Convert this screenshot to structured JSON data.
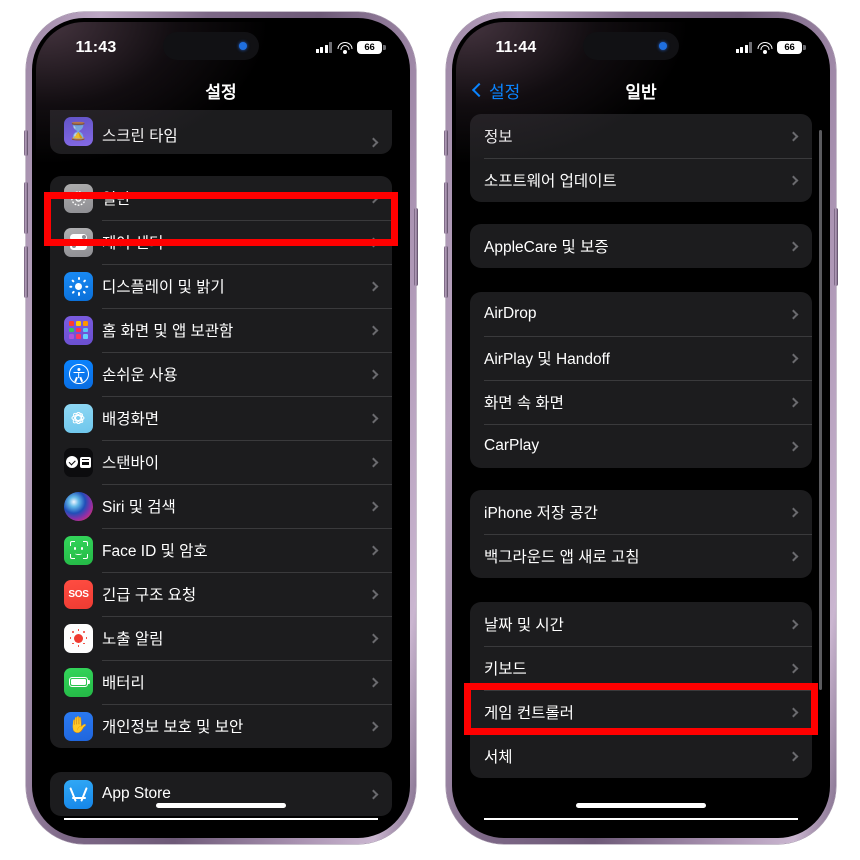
{
  "phones": [
    {
      "id": "phone-left",
      "status_bar": {
        "time": "11:43",
        "battery_level": "66",
        "cellular_icon": "cellular-bars-icon",
        "wifi_icon": "wifi-icon",
        "battery_icon": "battery-icon",
        "dynamic_island_icon": "dynamic-island-indicator-icon"
      },
      "nav": {
        "title": "설정",
        "has_back": false,
        "back_label": ""
      },
      "groups": [
        {
          "rows": [
            {
              "label": "스크린 타임",
              "icon": "screen-time-icon",
              "icon_class": "ic-screentime",
              "glyph": "hourglass"
            }
          ]
        },
        {
          "rows": [
            {
              "label": "일반",
              "icon": "general-gear-icon",
              "icon_class": "ic-general",
              "glyph": "gear",
              "highlighted": true
            },
            {
              "label": "제어 센터",
              "icon": "control-center-icon",
              "icon_class": "ic-control",
              "glyph": "sliders"
            },
            {
              "label": "디스플레이 및 밝기",
              "icon": "display-brightness-icon",
              "icon_class": "ic-display",
              "glyph": "sun"
            },
            {
              "label": "홈 화면 및 앱 보관함",
              "icon": "home-screen-icon",
              "icon_class": "ic-home",
              "glyph": "grid"
            },
            {
              "label": "손쉬운 사용",
              "icon": "accessibility-icon",
              "icon_class": "ic-access",
              "glyph": "person"
            },
            {
              "label": "배경화면",
              "icon": "wallpaper-icon",
              "icon_class": "ic-wallpaper",
              "glyph": "flower"
            },
            {
              "label": "스탠바이",
              "icon": "standby-icon",
              "icon_class": "ic-standby",
              "glyph": "standby"
            },
            {
              "label": "Siri 및 검색",
              "icon": "siri-icon",
              "icon_class": "ic-siri",
              "glyph": "none"
            },
            {
              "label": "Face ID 및 암호",
              "icon": "face-id-icon",
              "icon_class": "ic-faceid",
              "glyph": "faceid"
            },
            {
              "label": "긴급 구조 요청",
              "icon": "emergency-sos-icon",
              "icon_class": "ic-sos",
              "glyph": "sos"
            },
            {
              "label": "노출 알림",
              "icon": "exposure-notifications-icon",
              "icon_class": "ic-exposure",
              "glyph": "exposure"
            },
            {
              "label": "배터리",
              "icon": "battery-settings-icon",
              "icon_class": "ic-battery",
              "glyph": "battery"
            },
            {
              "label": "개인정보 보호 및 보안",
              "icon": "privacy-security-icon",
              "icon_class": "ic-privacy",
              "glyph": "hand"
            }
          ]
        },
        {
          "rows": [
            {
              "label": "App Store",
              "icon": "app-store-icon",
              "icon_class": "ic-appstore",
              "glyph": "appstore"
            }
          ]
        }
      ]
    },
    {
      "id": "phone-right",
      "status_bar": {
        "time": "11:44",
        "battery_level": "66",
        "cellular_icon": "cellular-bars-icon",
        "wifi_icon": "wifi-icon",
        "battery_icon": "battery-icon",
        "dynamic_island_icon": "dynamic-island-indicator-icon"
      },
      "nav": {
        "title": "일반",
        "has_back": true,
        "back_label": "설정"
      },
      "groups": [
        {
          "rows": [
            {
              "label": "정보"
            },
            {
              "label": "소프트웨어 업데이트"
            }
          ]
        },
        {
          "rows": [
            {
              "label": "AppleCare 및 보증"
            }
          ]
        },
        {
          "rows": [
            {
              "label": "AirDrop"
            },
            {
              "label": "AirPlay 및 Handoff"
            },
            {
              "label": "화면 속 화면"
            },
            {
              "label": "CarPlay"
            }
          ]
        },
        {
          "rows": [
            {
              "label": "iPhone 저장 공간"
            },
            {
              "label": "백그라운드 앱 새로 고침"
            }
          ]
        },
        {
          "rows": [
            {
              "label": "날짜 및 시간"
            },
            {
              "label": "키보드",
              "highlighted": true
            },
            {
              "label": "게임 컨트롤러"
            },
            {
              "label": "서체"
            }
          ]
        }
      ]
    }
  ],
  "annotation": {
    "highlight_color": "#ff0000",
    "highlight_targets": [
      "일반",
      "키보드"
    ]
  }
}
